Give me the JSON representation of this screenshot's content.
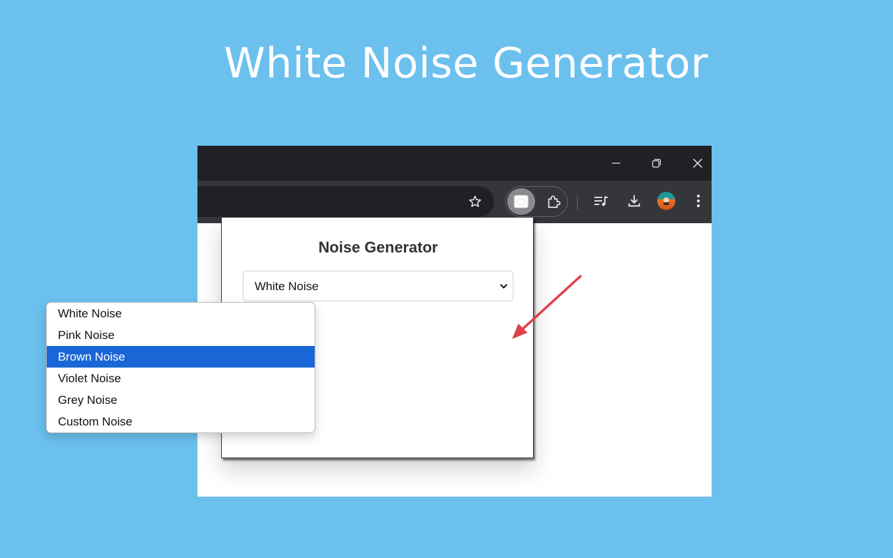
{
  "hero": {
    "title": "White Noise Generator"
  },
  "browser": {
    "window_controls": [
      "minimize-icon",
      "restore-icon",
      "close-icon"
    ],
    "toolbar_icons": [
      "star-icon",
      "extension-active-icon",
      "puzzle-icon",
      "media-controls-icon",
      "download-icon",
      "avatar",
      "more-icon"
    ]
  },
  "popup": {
    "title": "Noise Generator",
    "select": {
      "value": "White Noise"
    },
    "options": [
      {
        "label": "White Noise"
      },
      {
        "label": "Pink Noise"
      },
      {
        "label": "Brown Noise"
      },
      {
        "label": "Violet Noise"
      },
      {
        "label": "Grey Noise"
      },
      {
        "label": "Custom Noise"
      }
    ],
    "highlighted_option": "Brown Noise"
  },
  "colors": {
    "background": "#6bc0ee",
    "highlight": "#1b66d6",
    "arrow": "#e0404a"
  }
}
